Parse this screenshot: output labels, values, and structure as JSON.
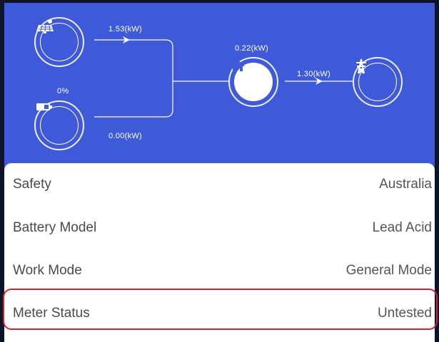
{
  "flow": {
    "solar_power": "1.53(kW)",
    "battery_soc": "0%",
    "battery_power": "0.00(kW)",
    "home_power": "0.22(kW)",
    "grid_power": "1.30(kW)",
    "icons": {
      "solar": "solar-panel-icon",
      "battery": "battery-icon",
      "home": "house-icon",
      "grid": "power-tower-icon"
    }
  },
  "details": [
    {
      "label": "Safety",
      "value": "Australia"
    },
    {
      "label": "Battery Model",
      "value": "Lead Acid"
    },
    {
      "label": "Work Mode",
      "value": "General Mode"
    },
    {
      "label": "Meter Status",
      "value": "Untested"
    }
  ],
  "colors": {
    "header_bg": "#3f5ad8",
    "highlight": "#d9202a",
    "outer_bg": "#0f1426"
  }
}
